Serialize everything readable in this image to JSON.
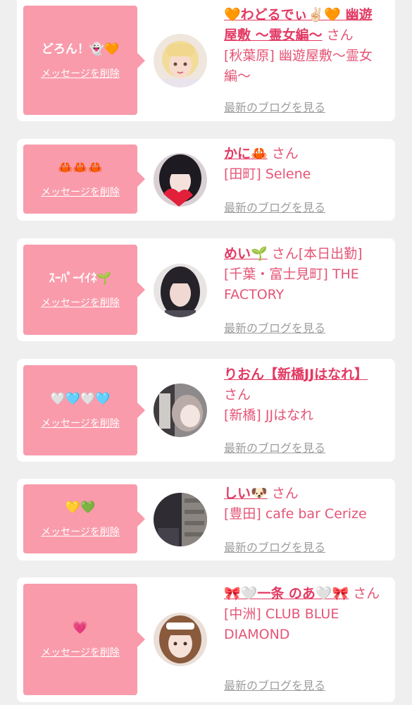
{
  "cards": [
    {
      "message": "どろん！👻🧡",
      "delete_label": "メッセージを削除",
      "name": "🧡わどるでぃ✌🏻🧡 幽遊屋敷 〜霊女編〜",
      "honorific": "さん",
      "shop": "[秋葉原] 幽遊屋敷〜霊女編〜",
      "blog_label": "最新のブログを見る"
    },
    {
      "message": "🦀🦀🦀",
      "delete_label": "メッセージを削除",
      "name": "かに🦀",
      "honorific": "さん",
      "shop": "[田町] Selene",
      "blog_label": "最新のブログを見る"
    },
    {
      "message": "ｽｰﾊﾟｰｲｲﾈ🌱",
      "delete_label": "メッセージを削除",
      "name": "めい🌱",
      "honorific": "さん[本日出勤]",
      "shop": "[千葉・富士見町] THE FACTORY",
      "blog_label": "最新のブログを見る"
    },
    {
      "message": "🤍🩵🤍🩵",
      "delete_label": "メッセージを削除",
      "name": "りおん【新橋JJはなれ】",
      "honorific": "さん",
      "shop": "[新橋] JJはなれ",
      "blog_label": "最新のブログを見る"
    },
    {
      "message": "💛💚",
      "delete_label": "メッセージを削除",
      "name": "しい🐶",
      "honorific": "さん",
      "shop": "[豊田] cafe bar Cerize",
      "blog_label": "最新のブログを見る"
    },
    {
      "message": "💗",
      "delete_label": "メッセージを削除",
      "name": "🎀🤍一条 のあ🤍🎀",
      "honorific": "さん",
      "shop": "[中洲] CLUB BLUE DIAMOND",
      "blog_label": "最新のブログを見る"
    }
  ]
}
